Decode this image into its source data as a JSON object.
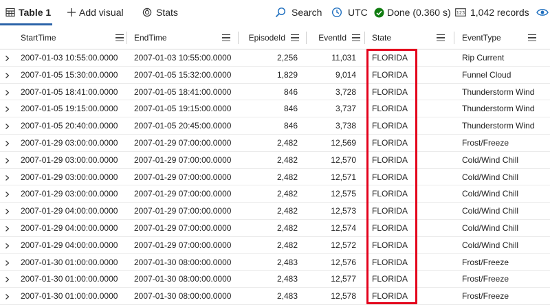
{
  "toolbar": {
    "table_tab": "Table 1",
    "add_visual": "Add visual",
    "stats": "Stats",
    "search": "Search",
    "timezone": "UTC",
    "status": "Done (0.360 s)",
    "records": "1,042 records"
  },
  "columns": [
    "StartTime",
    "EndTime",
    "EpisodeId",
    "EventId",
    "State",
    "EventType"
  ],
  "rows": [
    [
      "2007-01-03 10:55:00.0000",
      "2007-01-03 10:55:00.0000",
      "2,256",
      "11,031",
      "FLORIDA",
      "Rip Current"
    ],
    [
      "2007-01-05 15:30:00.0000",
      "2007-01-05 15:32:00.0000",
      "1,829",
      "9,014",
      "FLORIDA",
      "Funnel Cloud"
    ],
    [
      "2007-01-05 18:41:00.0000",
      "2007-01-05 18:41:00.0000",
      "846",
      "3,728",
      "FLORIDA",
      "Thunderstorm Wind"
    ],
    [
      "2007-01-05 19:15:00.0000",
      "2007-01-05 19:15:00.0000",
      "846",
      "3,737",
      "FLORIDA",
      "Thunderstorm Wind"
    ],
    [
      "2007-01-05 20:40:00.0000",
      "2007-01-05 20:45:00.0000",
      "846",
      "3,738",
      "FLORIDA",
      "Thunderstorm Wind"
    ],
    [
      "2007-01-29 03:00:00.0000",
      "2007-01-29 07:00:00.0000",
      "2,482",
      "12,569",
      "FLORIDA",
      "Frost/Freeze"
    ],
    [
      "2007-01-29 03:00:00.0000",
      "2007-01-29 07:00:00.0000",
      "2,482",
      "12,570",
      "FLORIDA",
      "Cold/Wind Chill"
    ],
    [
      "2007-01-29 03:00:00.0000",
      "2007-01-29 07:00:00.0000",
      "2,482",
      "12,571",
      "FLORIDA",
      "Cold/Wind Chill"
    ],
    [
      "2007-01-29 03:00:00.0000",
      "2007-01-29 07:00:00.0000",
      "2,482",
      "12,575",
      "FLORIDA",
      "Cold/Wind Chill"
    ],
    [
      "2007-01-29 04:00:00.0000",
      "2007-01-29 07:00:00.0000",
      "2,482",
      "12,573",
      "FLORIDA",
      "Cold/Wind Chill"
    ],
    [
      "2007-01-29 04:00:00.0000",
      "2007-01-29 07:00:00.0000",
      "2,482",
      "12,574",
      "FLORIDA",
      "Cold/Wind Chill"
    ],
    [
      "2007-01-29 04:00:00.0000",
      "2007-01-29 07:00:00.0000",
      "2,482",
      "12,572",
      "FLORIDA",
      "Cold/Wind Chill"
    ],
    [
      "2007-01-30 01:00:00.0000",
      "2007-01-30 08:00:00.0000",
      "2,483",
      "12,576",
      "FLORIDA",
      "Frost/Freeze"
    ],
    [
      "2007-01-30 01:00:00.0000",
      "2007-01-30 08:00:00.0000",
      "2,483",
      "12,577",
      "FLORIDA",
      "Frost/Freeze"
    ],
    [
      "2007-01-30 01:00:00.0000",
      "2007-01-30 08:00:00.0000",
      "2,483",
      "12,578",
      "FLORIDA",
      "Frost/Freeze"
    ]
  ],
  "icons": {
    "table": "table-icon",
    "add": "plus-icon",
    "stats": "stats-icon",
    "search": "search-icon",
    "clock": "clock-icon",
    "done": "check-circle-icon",
    "records": "records-icon",
    "view": "eye-icon"
  },
  "colors": {
    "accent": "#2b63a8",
    "done": "#107c10",
    "highlight": "#e3001b"
  }
}
